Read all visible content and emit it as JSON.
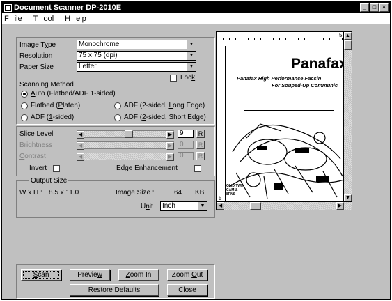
{
  "window": {
    "title": "Document Scanner DP-2010E"
  },
  "menu": [
    {
      "pre": "",
      "ul": "F",
      "post": "ile"
    },
    {
      "pre": "",
      "ul": "T",
      "post": "ool"
    },
    {
      "pre": "",
      "ul": "H",
      "post": "elp"
    }
  ],
  "image": {
    "type_label_pre": "Image T",
    "type_label_ul": "y",
    "type_label_post": "pe",
    "type_value": "Monochrome",
    "res_label_ul": "R",
    "res_label_post": "esolution",
    "res_value": "75 x 75 (dpi)",
    "paper_label_pre": "P",
    "paper_label_ul": "a",
    "paper_label_post": "per Size",
    "paper_value": "Letter",
    "lock_pre": "Loc",
    "lock_ul": "k"
  },
  "method": {
    "heading": "Scanning Method",
    "auto_pre": "",
    "auto_ul": "A",
    "auto_post": "uto (Flatbed/ADF 1-sided)",
    "flatbed_pre": "Flatbed (",
    "flatbed_ul": "P",
    "flatbed_post": "laten)",
    "adf1_pre": "ADF (",
    "adf1_ul": "1",
    "adf1_post": "-sided)",
    "adf2l_pre": "ADF (2-sided, ",
    "adf2l_ul": "L",
    "adf2l_post": "ong Edge)",
    "adf2s_pre": "ADF (",
    "adf2s_ul": "2",
    "adf2s_post": "-sided, Short Edge)",
    "selected": "auto"
  },
  "adjust": {
    "slice_pre": "Sl",
    "slice_ul": "i",
    "slice_post": "ce Level",
    "slice_value": "9",
    "slice_level_fraction": 0.55,
    "bright_pre": "",
    "bright_ul": "B",
    "bright_post": "rightness",
    "bright_value": "0",
    "contrast_pre": "",
    "contrast_ul": "C",
    "contrast_post": "ontrast",
    "contrast_value": "0",
    "reset": "R",
    "invert_pre": "In",
    "invert_ul": "v",
    "invert_post": "ert",
    "edge": "Edge Enhancement"
  },
  "output": {
    "heading": "Output Size",
    "wxh_label": "W x H :",
    "wxh_value": "8.5 x 11.0",
    "size_label": "Image Size :",
    "size_value": "64",
    "size_unit": "KB",
    "unit_pre": "U",
    "unit_ul": "n",
    "unit_post": "it",
    "unit_value": "Inch"
  },
  "buttons": {
    "scan_pre": "",
    "scan_ul": "S",
    "scan_post": "can",
    "preview_pre": "Previe",
    "preview_ul": "w",
    "preview_post": "",
    "zoomin_pre": "",
    "zoomin_ul": "Z",
    "zoomin_post": "oom In",
    "zoomout_pre": "Zoom ",
    "zoomout_ul": "O",
    "zoomout_post": "ut",
    "restore_pre": "Restore ",
    "restore_ul": "D",
    "restore_post": "efaults",
    "close_pre": "Clo",
    "close_ul": "s",
    "close_post": "e"
  },
  "preview": {
    "ruler_mark": "5",
    "side_mark": "5",
    "brand": "Panafax",
    "line1": "Panafax High Performance Facsin",
    "line2": "For Souped-Up Communic",
    "caption": "OLID TWIN CAM & 8PNS"
  }
}
